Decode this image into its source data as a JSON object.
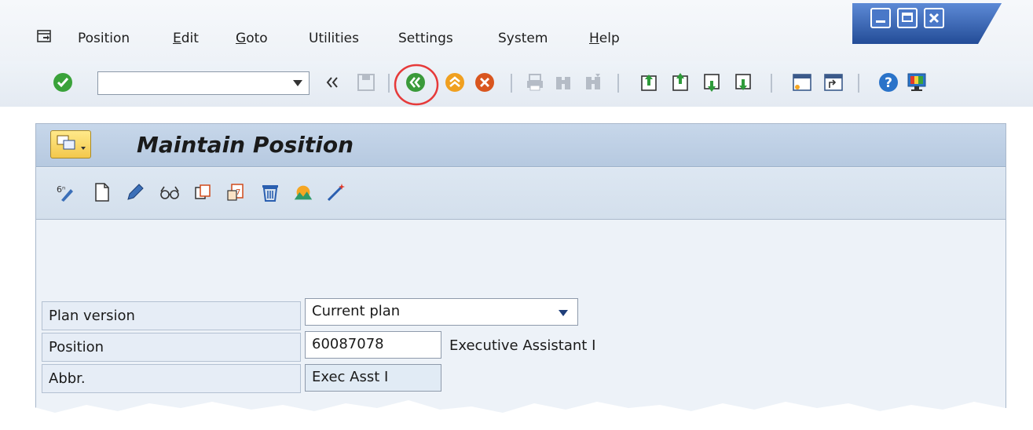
{
  "colors": {
    "accent": "#e63a3a",
    "ok_green": "#3aa23a",
    "title_blue": "#c7d7ea"
  },
  "menu": {
    "items": [
      {
        "label": "Position",
        "mnemonic": ""
      },
      {
        "label": "Edit",
        "mnemonic": "E"
      },
      {
        "label": "Goto",
        "mnemonic": "G"
      },
      {
        "label": "Utilities",
        "mnemonic": ""
      },
      {
        "label": "Settings",
        "mnemonic": ""
      },
      {
        "label": "System",
        "mnemonic": ""
      },
      {
        "label": "Help",
        "mnemonic": "H"
      }
    ]
  },
  "toolbar": {
    "command_value": "",
    "icons": [
      "ok-icon",
      "save-icon",
      "back-icon",
      "exit-icon",
      "cancel-icon",
      "print-icon",
      "find-icon",
      "find-next-icon",
      "first-page-icon",
      "prev-page-icon",
      "next-page-icon",
      "last-page-icon",
      "new-session-icon",
      "shortcut-icon",
      "help-icon",
      "customize-layout-icon"
    ],
    "highlighted": "back-icon"
  },
  "panel": {
    "title": "Maintain Position",
    "app_icons": [
      "overview-icon",
      "create-icon",
      "change-icon",
      "display-icon",
      "copy-icon",
      "delimit-icon",
      "delete-icon",
      "structure-icon",
      "wizard-icon"
    ]
  },
  "form": {
    "plan_version": {
      "label": "Plan version",
      "value": "Current plan"
    },
    "position": {
      "label": "Position",
      "value": "60087078",
      "description": "Executive Assistant I"
    },
    "abbr": {
      "label": "Abbr.",
      "value": "Exec Asst I"
    }
  }
}
